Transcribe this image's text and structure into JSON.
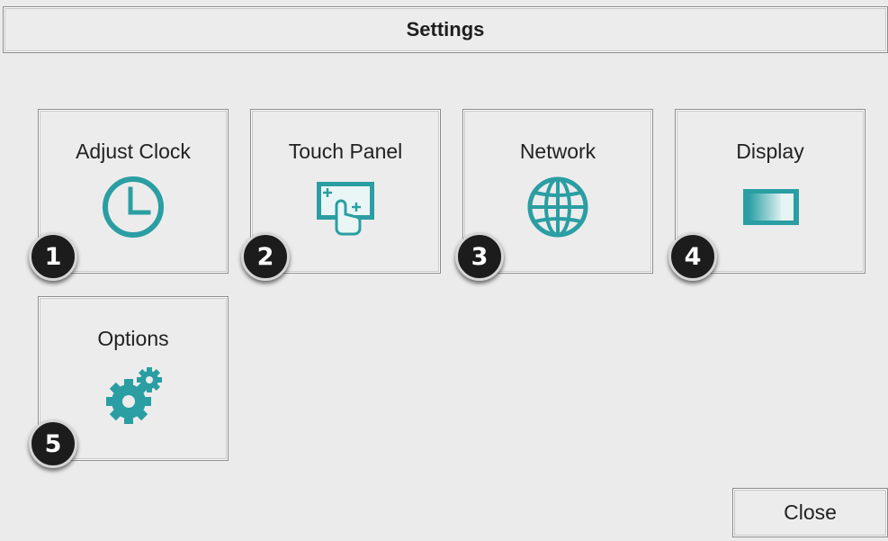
{
  "window": {
    "title": "Settings"
  },
  "tiles": [
    {
      "label": "Adjust Clock",
      "icon": "clock-icon",
      "badge": "1"
    },
    {
      "label": "Touch Panel",
      "icon": "touch-panel-icon",
      "badge": "2"
    },
    {
      "label": "Network",
      "icon": "globe-icon",
      "badge": "3"
    },
    {
      "label": "Display",
      "icon": "display-icon",
      "badge": "4"
    },
    {
      "label": "Options",
      "icon": "gears-icon",
      "badge": "5"
    }
  ],
  "close": {
    "label": "Close"
  },
  "colors": {
    "accent": "#2a9ea3",
    "background": "#ebebeb",
    "badge": "#1c1c1c"
  }
}
